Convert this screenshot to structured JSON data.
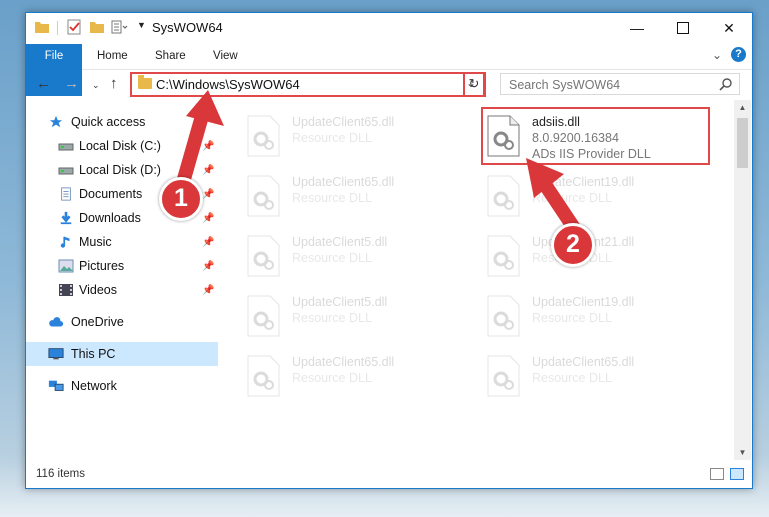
{
  "window": {
    "title": "SysWOW64"
  },
  "ribbon": {
    "tabs": [
      "File",
      "Home",
      "Share",
      "View"
    ]
  },
  "address": {
    "path": "C:\\Windows\\SysWOW64"
  },
  "search": {
    "placeholder": "Search SysWOW64"
  },
  "sidebar": {
    "items": [
      {
        "label": "Quick access",
        "icon": "star-icon"
      },
      {
        "label": "Local Disk (C:)",
        "icon": "drive-icon",
        "pinned": true
      },
      {
        "label": "Local Disk (D:)",
        "icon": "drive-icon",
        "pinned": true
      },
      {
        "label": "Documents",
        "icon": "documents-icon",
        "pinned": true
      },
      {
        "label": "Downloads",
        "icon": "download-icon",
        "pinned": true
      },
      {
        "label": "Music",
        "icon": "music-icon",
        "pinned": true
      },
      {
        "label": "Pictures",
        "icon": "pictures-icon",
        "pinned": true
      },
      {
        "label": "Videos",
        "icon": "videos-icon",
        "pinned": true
      },
      {
        "label": "OneDrive",
        "icon": "cloud-icon"
      },
      {
        "label": "This PC",
        "icon": "computer-icon",
        "selected": true
      },
      {
        "label": "Network",
        "icon": "network-icon"
      }
    ]
  },
  "files": [
    {
      "name": "UpdateClient65.dll",
      "type": "Resource DLL"
    },
    {
      "name": "adsiis.dll",
      "version": "8.0.9200.16384",
      "description": "ADs IIS Provider DLL"
    },
    {
      "name": "UpdateClient65.dll",
      "type": "Resource DLL"
    },
    {
      "name": "UpdateClient19.dll",
      "type": "Resource DLL"
    },
    {
      "name": "UpdateClient5.dll",
      "type": "Resource DLL"
    },
    {
      "name": "UpdateClient21.dll",
      "type": "Resource DLL"
    },
    {
      "name": "UpdateClient5.dll",
      "type": "Resource DLL"
    },
    {
      "name": "UpdateClient19.dll",
      "type": "Resource DLL"
    },
    {
      "name": "UpdateClient65.dll",
      "type": "Resource DLL"
    },
    {
      "name": "UpdateClient65.dll",
      "type": "Resource DLL"
    }
  ],
  "status": {
    "item_count": "116 items"
  },
  "annotations": {
    "step1": "1",
    "step2": "2"
  },
  "colors": {
    "accent": "#1979ca",
    "annotation": "#e0484a",
    "selected": "#cce8ff"
  }
}
